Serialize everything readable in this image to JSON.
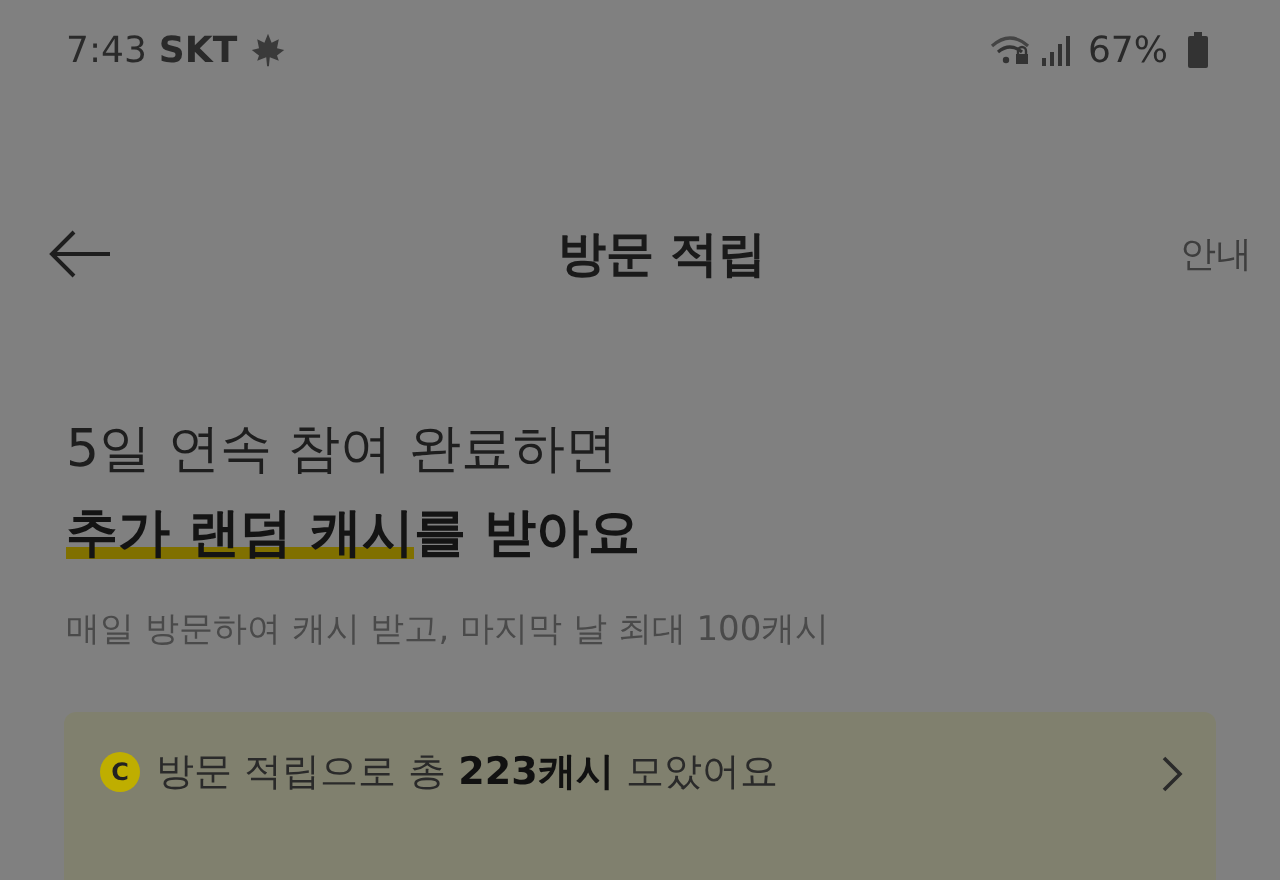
{
  "status_bar": {
    "time": "7:43",
    "carrier": "SKT",
    "battery": "67%"
  },
  "nav": {
    "title": "방문 적립",
    "action": "안내"
  },
  "headline": {
    "line1": "5일 연속 참여 완료하면",
    "highlight": "추가 랜덤 캐시",
    "rest": "를 받아요"
  },
  "subtitle": "매일 방문하여 캐시 받고, 마지막 날 최대 100캐시",
  "summary": {
    "coin": "C",
    "text": "방문 적립으로 총 **223캐시** 모았어요"
  }
}
